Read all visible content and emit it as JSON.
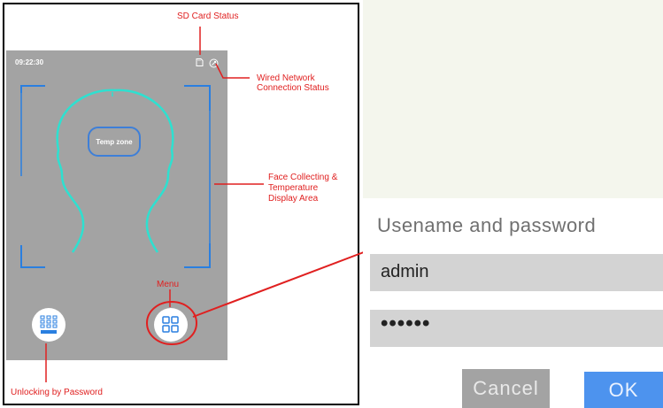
{
  "device": {
    "time": "09:22:30",
    "temp_zone_label": "Temp zone"
  },
  "annotations": {
    "sd_card_status": "SD Card Status",
    "wired_network": "Wired Network",
    "connection_status": "Connection Status",
    "face_collecting": "Face Collecting &",
    "temperature": "Temperature",
    "display_area": "Display Area",
    "menu": "Menu",
    "unlocking_by_password": "Unlocking by Password"
  },
  "login_dialog": {
    "title": "Usename and password",
    "username_value": "admin",
    "password_value": "••••••",
    "cancel_label": "Cancel",
    "ok_label": "OK"
  },
  "colors": {
    "screen_bg": "#a3a3a3",
    "bracket_blue": "#2a7fe0",
    "head_outline_cyan": "#2ee0d0",
    "annotation_red": "#e02020",
    "ok_blue": "#4d93ee"
  }
}
